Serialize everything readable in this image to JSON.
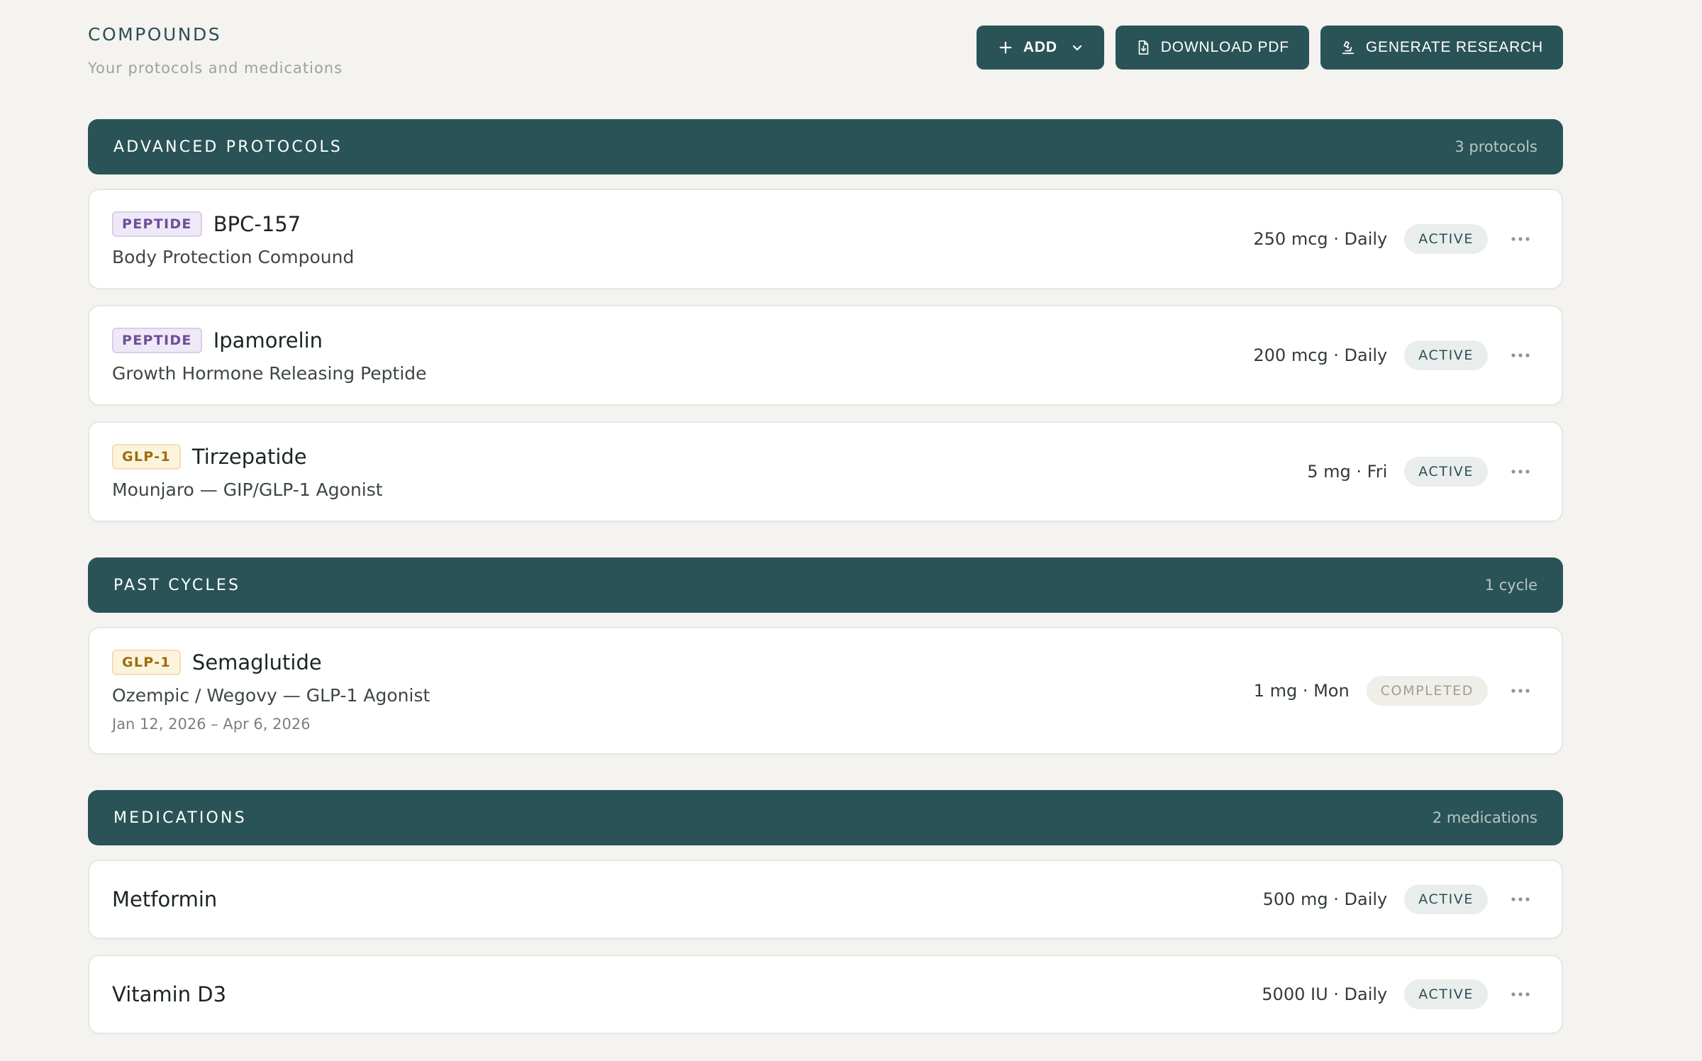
{
  "header": {
    "title": "COMPOUNDS",
    "subtitle": "Your protocols and medications",
    "actions": {
      "add": "ADD",
      "download_pdf": "DOWNLOAD PDF",
      "generate_research": "GENERATE RESEARCH"
    }
  },
  "sections": {
    "advanced": {
      "title": "ADVANCED PROTOCOLS",
      "count": "3 protocols",
      "items": [
        {
          "tag": "PEPTIDE",
          "name": "BPC-157",
          "description": "Body Protection Compound",
          "dose": "250 mcg · Daily",
          "status": "ACTIVE"
        },
        {
          "tag": "PEPTIDE",
          "name": "Ipamorelin",
          "description": "Growth Hormone Releasing Peptide",
          "dose": "200 mcg · Daily",
          "status": "ACTIVE"
        },
        {
          "tag": "GLP-1",
          "name": "Tirzepatide",
          "description": "Mounjaro — GIP/GLP-1 Agonist",
          "dose": "5 mg · Fri",
          "status": "ACTIVE"
        }
      ]
    },
    "past": {
      "title": "PAST CYCLES",
      "count": "1 cycle",
      "items": [
        {
          "tag": "GLP-1",
          "name": "Semaglutide",
          "description": "Ozempic / Wegovy — GLP-1 Agonist",
          "dates": "Jan 12, 2026 – Apr 6, 2026",
          "dose": "1 mg · Mon",
          "status": "COMPLETED"
        }
      ]
    },
    "medications": {
      "title": "MEDICATIONS",
      "count": "2 medications",
      "items": [
        {
          "name": "Metformin",
          "dose": "500 mg · Daily",
          "status": "ACTIVE"
        },
        {
          "name": "Vitamin D3",
          "dose": "5000 IU · Daily",
          "status": "ACTIVE"
        }
      ]
    }
  },
  "colors": {
    "primary": "#2a5357",
    "background": "#f4f3f0",
    "peptide_tag": "#6c4f98",
    "glp_tag": "#9b6c10"
  }
}
